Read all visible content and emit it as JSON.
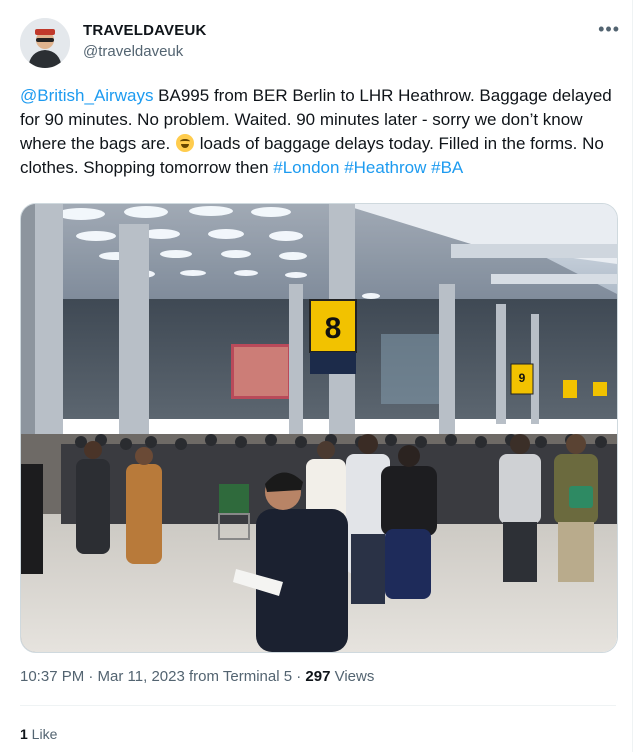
{
  "author": {
    "display_name": "TRAVELDAVEUK",
    "handle": "@traveldaveuk",
    "avatar_icon": "user-avatar"
  },
  "menu": {
    "more_label": "•••"
  },
  "tweet": {
    "mention": "@British_Airways",
    "text_1": " BA995 from BER Berlin  to LHR Heathrow. Baggage delayed for 90 minutes. No problem. Waited. 90 minutes later - sorry we don’t know where the bags are. ",
    "emoji": "rolling-on-floor-laughing-emoji",
    "text_2": " loads of baggage delays today. Filled in the forms. No clothes. Shopping tomorrow then ",
    "hashtag_1": "#London",
    "hashtag_2": "#Heathrow",
    "hashtag_3": "#BA"
  },
  "photo": {
    "gate_sign_number": "8",
    "gate_sign_number_2": "9",
    "link_color": "#1d9bf0"
  },
  "meta": {
    "time_date": "10:37 PM · Mar 11, 2023 from Terminal 5 · ",
    "views_count": "297",
    "views_label": " Views"
  },
  "engagement": {
    "likes_count": "1",
    "likes_label": " Like"
  }
}
